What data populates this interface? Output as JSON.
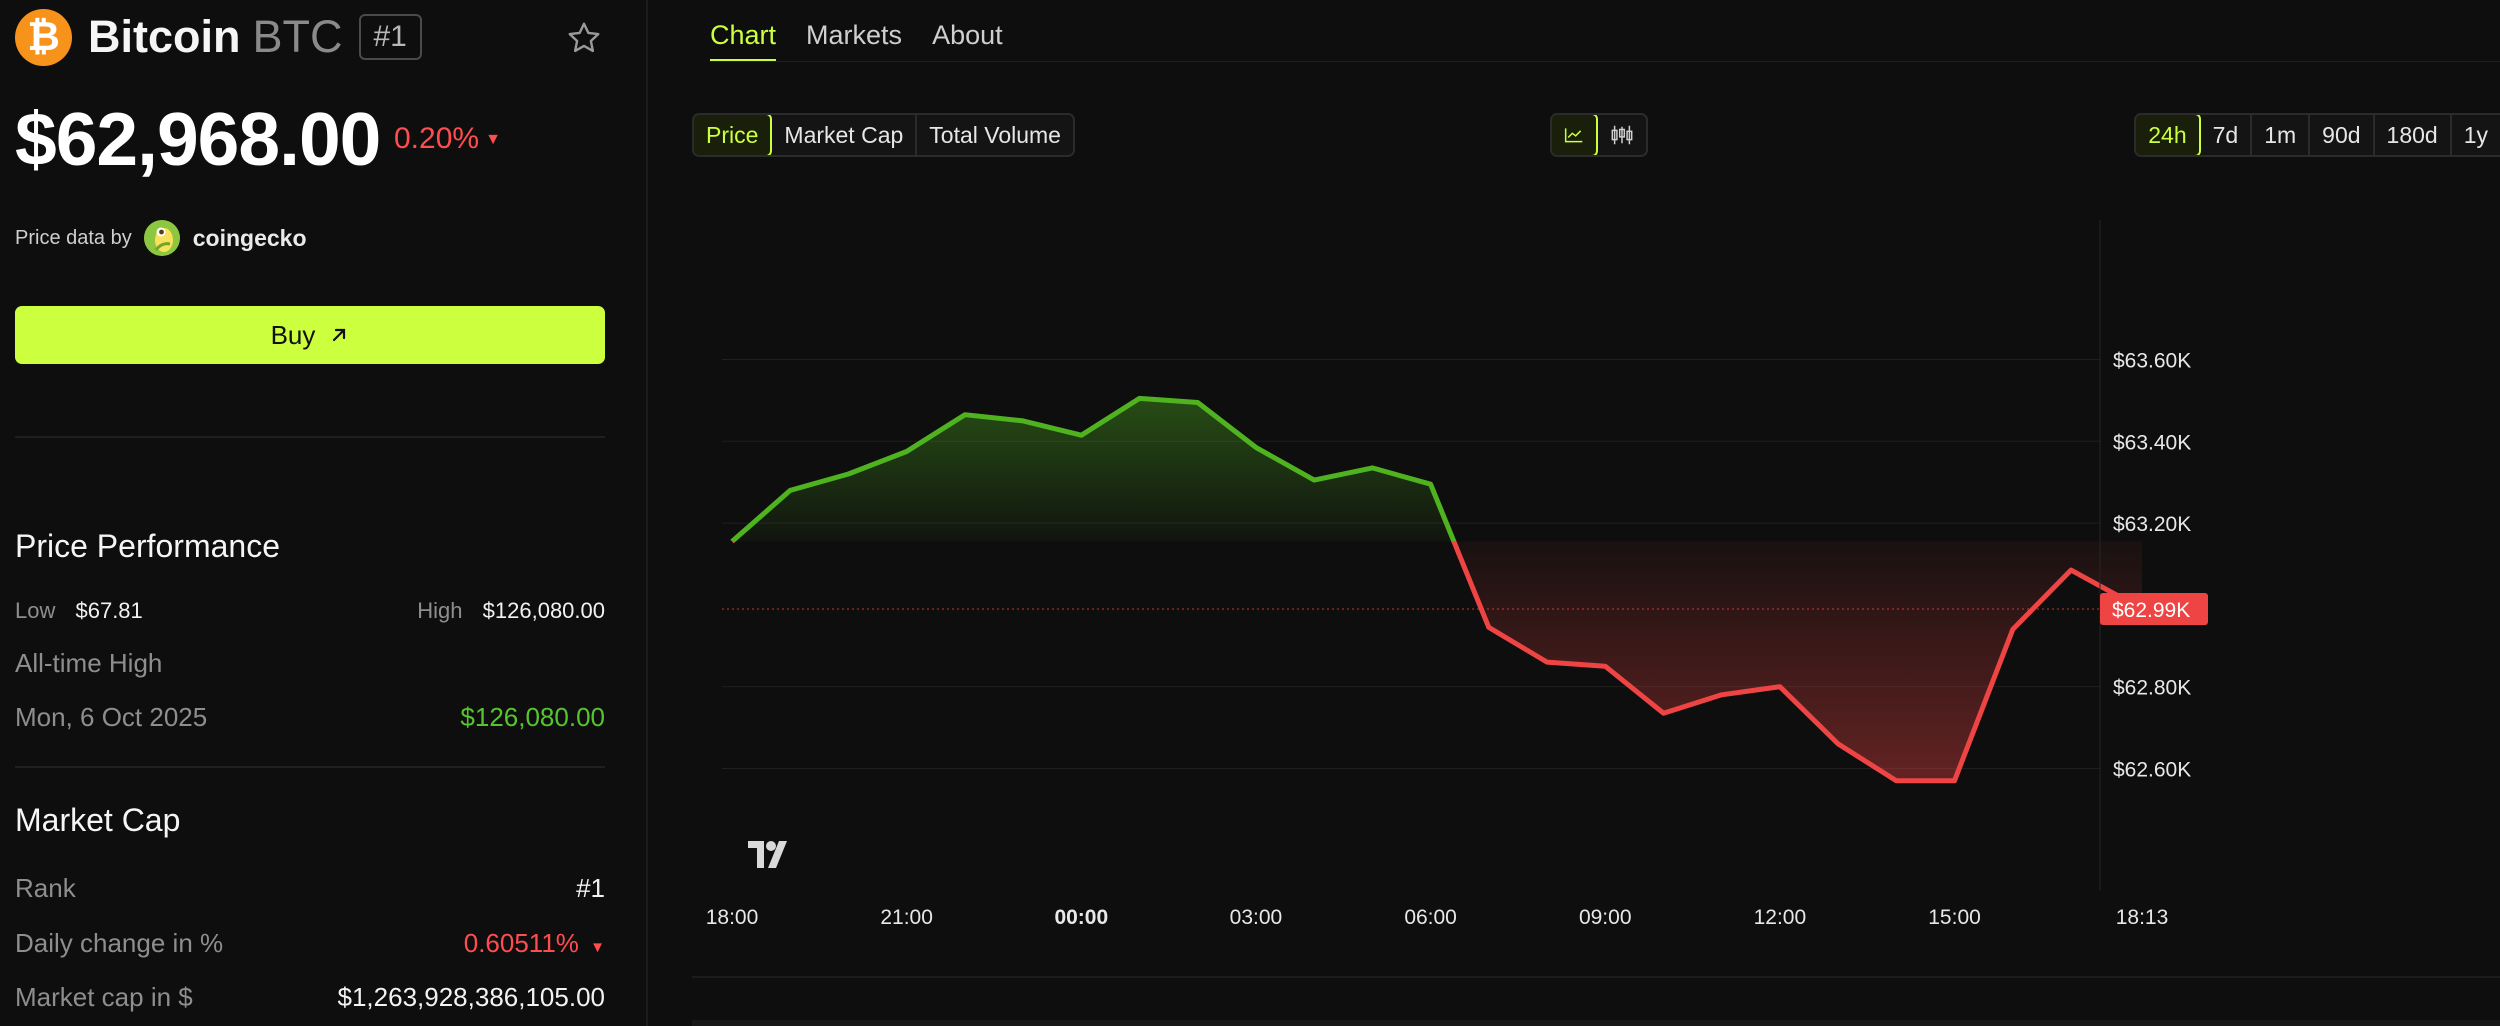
{
  "coin": {
    "logo_glyph": "₿",
    "name": "Bitcoin",
    "symbol": "BTC",
    "rank_badge": "#1",
    "price": "$62,968.00",
    "change": "0.20%",
    "change_arrow": "▼",
    "change_color": "#ff4d4f"
  },
  "provider": {
    "label": "Price data by",
    "name": "coingecko"
  },
  "buy": {
    "label": "Buy"
  },
  "performance": {
    "title": "Price Performance",
    "low_label": "Low",
    "low_value": "$67.81",
    "high_label": "High",
    "high_value": "$126,080.00",
    "ath_label": "All-time High",
    "ath_date": "Mon, 6 Oct 2025",
    "ath_value": "$126,080.00"
  },
  "market_cap": {
    "title": "Market Cap",
    "rank_label": "Rank",
    "rank_value": "#1",
    "daily_label": "Daily change in %",
    "daily_value": "0.60511%",
    "daily_arrow": "▼",
    "cap_label": "Market cap in $",
    "cap_value": "$1,263,928,386,105.00"
  },
  "tabs": [
    {
      "label": "Chart",
      "active": true
    },
    {
      "label": "Markets",
      "active": false
    },
    {
      "label": "About",
      "active": false
    }
  ],
  "metric_options": [
    "Price",
    "Market Cap",
    "Total Volume"
  ],
  "metric_selected": "Price",
  "chart_type_options": [
    "line-chart-icon",
    "candlestick-icon"
  ],
  "chart_type_selected": "line-chart-icon",
  "range_options": [
    "24h",
    "7d",
    "1m",
    "90d",
    "180d",
    "1y"
  ],
  "range_selected": "24h",
  "colors": {
    "accent": "#ccff3d",
    "up": "#4fb320",
    "down": "#ef4444",
    "background": "#0e0e0e"
  },
  "chart_data": {
    "type": "area",
    "x_labels": [
      "18:00",
      "21:00",
      "00:00",
      "03:00",
      "06:00",
      "09:00",
      "12:00",
      "15:00",
      "18:13"
    ],
    "x_label_bold": "00:00",
    "x": [
      "18:00",
      "19:00",
      "20:00",
      "21:00",
      "22:00",
      "23:00",
      "00:00",
      "01:00",
      "02:00",
      "03:00",
      "04:00",
      "05:00",
      "06:00",
      "07:00",
      "08:00",
      "09:00",
      "10:00",
      "11:00",
      "12:00",
      "13:00",
      "14:00",
      "15:00",
      "16:00",
      "17:00",
      "18:13"
    ],
    "x_hours": [
      0,
      1,
      2,
      3,
      4,
      5,
      6,
      7,
      8,
      9,
      10,
      11,
      12,
      13,
      14,
      15,
      16,
      17,
      18,
      19,
      20,
      21,
      22,
      23,
      24.22
    ],
    "values": [
      63155,
      63280,
      63320,
      63375,
      63465,
      63450,
      63415,
      63505,
      63495,
      63385,
      63305,
      63335,
      63295,
      62945,
      62860,
      62850,
      62735,
      62780,
      62800,
      62660,
      62570,
      62570,
      62940,
      63085,
      62990
    ],
    "baseline": 63155,
    "current_price_label": "$62.99K",
    "current_price": 62990,
    "y_ticks": [
      63600,
      63400,
      63200,
      62800,
      62600
    ],
    "y_tick_labels": [
      "$63.60K",
      "$63.40K",
      "$63.20K",
      "$62.80K",
      "$62.60K"
    ],
    "ylim": [
      62425,
      63770
    ],
    "grid": true,
    "watermark": "TV"
  }
}
